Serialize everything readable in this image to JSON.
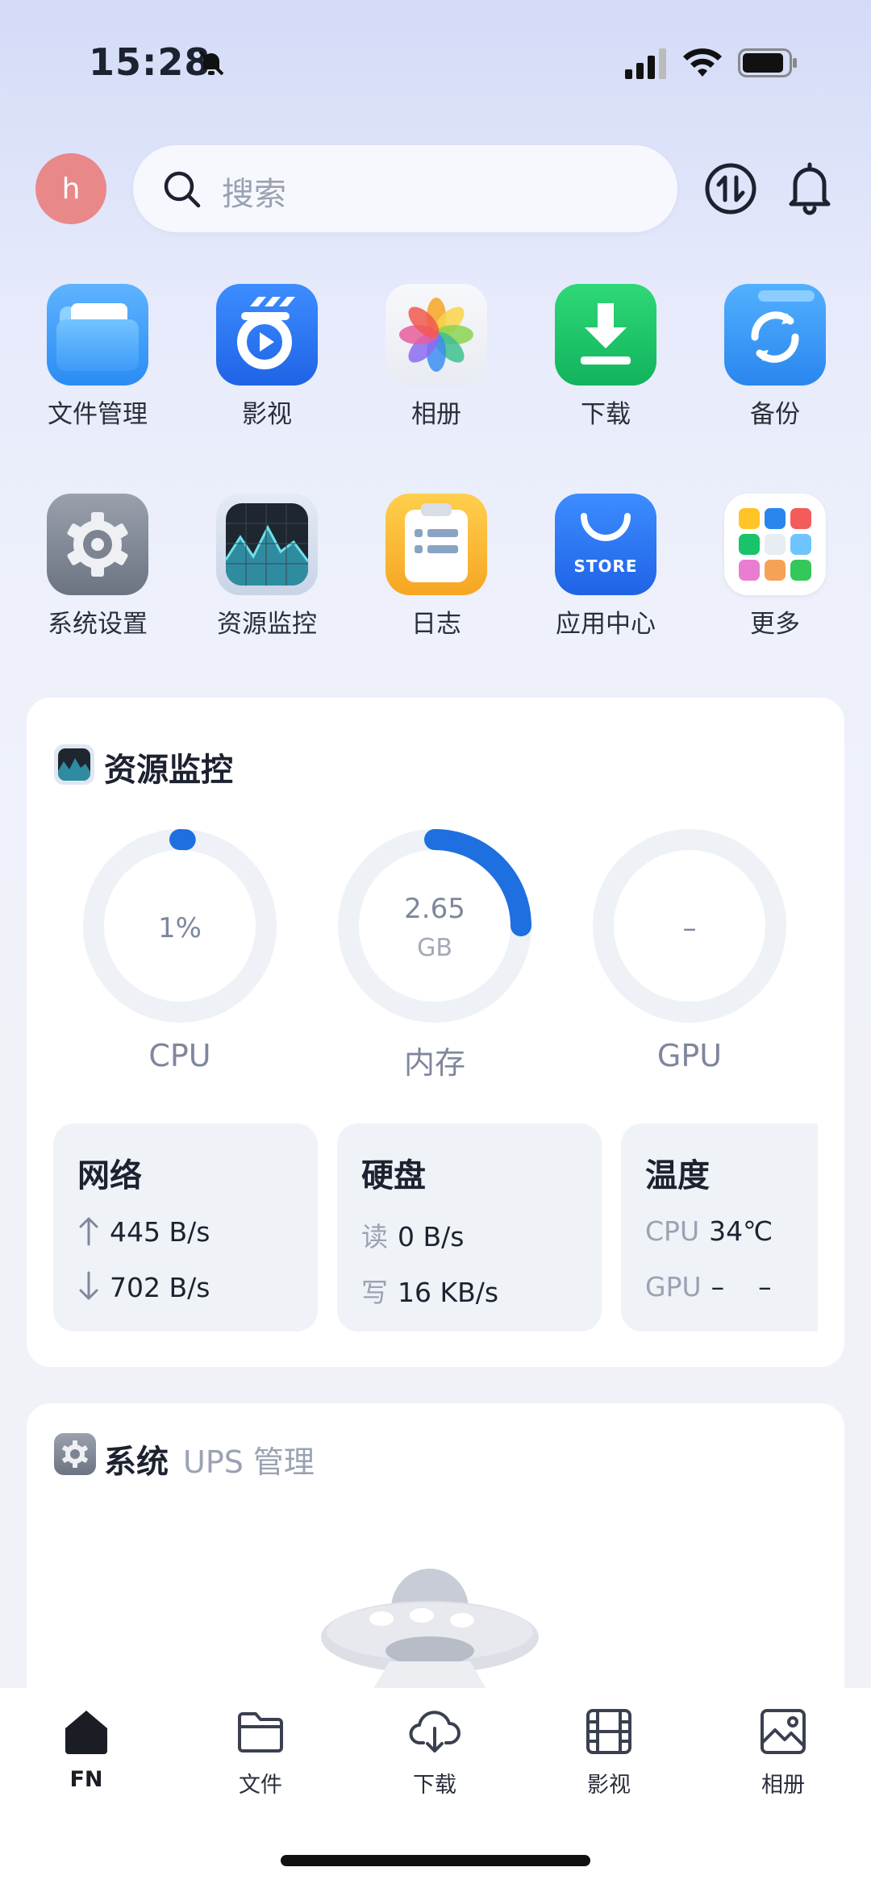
{
  "status_bar": {
    "time": "15:28"
  },
  "header": {
    "avatar_letter": "h",
    "search_placeholder": "搜索"
  },
  "apps": [
    {
      "label": "文件管理",
      "icon": "folder-icon"
    },
    {
      "label": "影视",
      "icon": "video-icon"
    },
    {
      "label": "相册",
      "icon": "photos-icon"
    },
    {
      "label": "下载",
      "icon": "download-icon"
    },
    {
      "label": "备份",
      "icon": "backup-icon"
    },
    {
      "label": "系统设置",
      "icon": "settings-icon"
    },
    {
      "label": "资源监控",
      "icon": "monitor-icon"
    },
    {
      "label": "日志",
      "icon": "log-icon"
    },
    {
      "label": "应用中心",
      "icon": "store-icon",
      "badge_text": "STORE"
    },
    {
      "label": "更多",
      "icon": "more-apps-icon"
    }
  ],
  "resource_card": {
    "title": "资源监控",
    "gauges": [
      {
        "label": "CPU",
        "value": "1%",
        "fraction": 0.01
      },
      {
        "label": "内存",
        "value": "2.65",
        "unit": "GB",
        "fraction": 0.25
      },
      {
        "label": "GPU",
        "value": "–",
        "fraction": 0
      }
    ],
    "network": {
      "title": "网络",
      "up": "445 B/s",
      "down": "702 B/s"
    },
    "disk": {
      "title": "硬盘",
      "read_key": "读",
      "read": "0 B/s",
      "write_key": "写",
      "write": "16 KB/s"
    },
    "temperature": {
      "title": "温度",
      "cpu_key": "CPU",
      "cpu": "34℃",
      "gpu_key": "GPU",
      "gpu": "–    –"
    }
  },
  "system_card": {
    "title": "系统",
    "subtitle": "UPS 管理"
  },
  "bottom_nav": [
    {
      "label": "FN",
      "icon": "home-icon"
    },
    {
      "label": "文件",
      "icon": "folder-icon"
    },
    {
      "label": "下载",
      "icon": "download-icon"
    },
    {
      "label": "影视",
      "icon": "film-icon"
    },
    {
      "label": "相册",
      "icon": "photo-icon"
    }
  ],
  "colors": {
    "accent": "#1e6fe0",
    "avatar": "#e98888",
    "gauge_track": "#eef1f6"
  }
}
